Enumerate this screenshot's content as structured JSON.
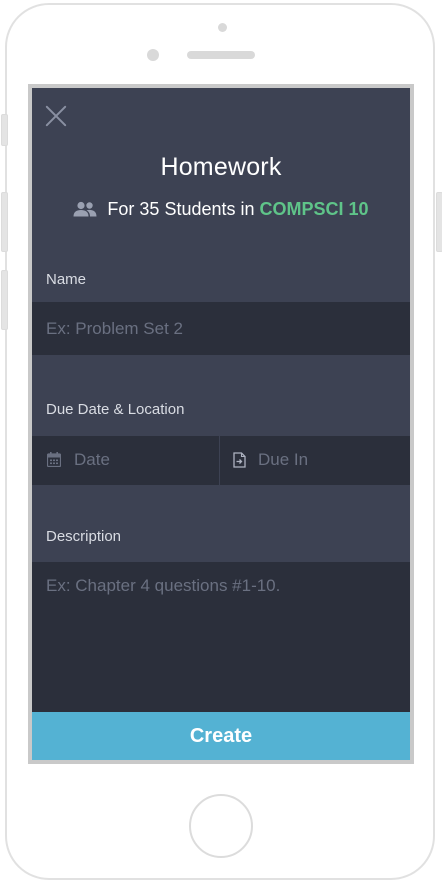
{
  "header": {
    "title": "Homework",
    "subtitle_prefix": "For 35 Students in",
    "class_name": "COMPSCI 10"
  },
  "form": {
    "name": {
      "label": "Name",
      "placeholder": "Ex: Problem Set 2"
    },
    "due": {
      "label": "Due Date & Location",
      "date_placeholder": "Date",
      "due_in_placeholder": "Due In"
    },
    "description": {
      "label": "Description",
      "placeholder": "Ex: Chapter 4 questions #1-10."
    }
  },
  "actions": {
    "create_label": "Create"
  },
  "icons": [
    "close-icon",
    "people-icon",
    "calendar-icon",
    "document-arrow-icon"
  ],
  "colors": {
    "background": "#3d4253",
    "field": "#2b2f3b",
    "accent_green": "#5fc489",
    "create_button": "#54b2d3"
  }
}
